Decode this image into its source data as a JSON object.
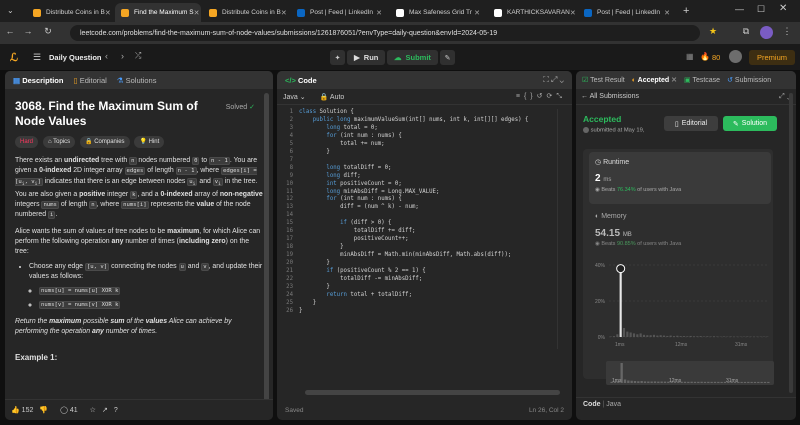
{
  "browser": {
    "tabs": [
      {
        "label": "Distribute Coins in B",
        "color": "#f5a623",
        "active": false
      },
      {
        "label": "Find the Maximum S",
        "color": "#f5a623",
        "active": true
      },
      {
        "label": "Distribute Coins in B",
        "color": "#f5a623",
        "active": false
      },
      {
        "label": "Post | Feed | LinkedIn",
        "color": "#0a66c2",
        "active": false
      },
      {
        "label": "Max Safeness Grid Tr",
        "color": "#ffffff",
        "active": false
      },
      {
        "label": "KARTHICKSAVARAN",
        "color": "#ffffff",
        "active": false
      },
      {
        "label": "Post | Feed | LinkedIn",
        "color": "#0a66c2",
        "active": false
      }
    ],
    "url": "leetcode.com/problems/find-the-maximum-sum-of-node-values/submissions/1261876051/?envType=daily-question&envId=2024-05-19"
  },
  "header": {
    "problem_list": "Daily Question",
    "run": "Run",
    "submit": "Submit",
    "streak": "80",
    "premium": "Premium"
  },
  "left": {
    "tabs": [
      "Description",
      "Editorial",
      "Solutions"
    ],
    "title": "3068. Find the Maximum Sum of Node Values",
    "solved": "Solved",
    "difficulty": "Hard",
    "tags": [
      "Topics",
      "Companies",
      "Hint"
    ],
    "likes": "152",
    "comments": "41",
    "example": "Example 1:"
  },
  "code": {
    "title": "Code",
    "lang": "Java",
    "auto": "Auto",
    "lines": [
      [
        [
          "kw",
          "class "
        ],
        [
          "tx",
          "Solution {"
        ]
      ],
      [
        [
          "tx",
          "    "
        ],
        [
          "kw",
          "public long "
        ],
        [
          "tx",
          "maximumValueSum(int[] nums, int k, int[][] edges) {"
        ]
      ],
      [
        [
          "tx",
          "        "
        ],
        [
          "kw",
          "long "
        ],
        [
          "tx",
          "total = 0;"
        ]
      ],
      [
        [
          "tx",
          "        "
        ],
        [
          "kw",
          "for "
        ],
        [
          "tx",
          "(int num : nums) {"
        ]
      ],
      [
        [
          "tx",
          "            total += num;"
        ]
      ],
      [
        [
          "tx",
          "        }"
        ]
      ],
      [
        [
          "tx",
          ""
        ]
      ],
      [
        [
          "tx",
          "        "
        ],
        [
          "kw",
          "long "
        ],
        [
          "tx",
          "totalDiff = 0;"
        ]
      ],
      [
        [
          "tx",
          "        "
        ],
        [
          "kw",
          "long "
        ],
        [
          "tx",
          "diff;"
        ]
      ],
      [
        [
          "tx",
          "        "
        ],
        [
          "kw",
          "int "
        ],
        [
          "tx",
          "positiveCount = 0;"
        ]
      ],
      [
        [
          "tx",
          "        "
        ],
        [
          "kw",
          "long "
        ],
        [
          "tx",
          "minAbsDiff = Long.MAX_VALUE;"
        ]
      ],
      [
        [
          "tx",
          "        "
        ],
        [
          "kw",
          "for "
        ],
        [
          "tx",
          "(int num : nums) {"
        ]
      ],
      [
        [
          "tx",
          "            diff = (num ^ k) - num;"
        ]
      ],
      [
        [
          "tx",
          ""
        ]
      ],
      [
        [
          "tx",
          "            "
        ],
        [
          "kw",
          "if "
        ],
        [
          "tx",
          "(diff > 0) {"
        ]
      ],
      [
        [
          "tx",
          "                totalDiff += diff;"
        ]
      ],
      [
        [
          "tx",
          "                positiveCount++;"
        ]
      ],
      [
        [
          "tx",
          "            }"
        ]
      ],
      [
        [
          "tx",
          "            minAbsDiff = Math.min(minAbsDiff, Math.abs(diff));"
        ]
      ],
      [
        [
          "tx",
          "        }"
        ]
      ],
      [
        [
          "tx",
          "        "
        ],
        [
          "kw",
          "if "
        ],
        [
          "tx",
          "(positiveCount % 2 == 1) {"
        ]
      ],
      [
        [
          "tx",
          "            totalDiff -= minAbsDiff;"
        ]
      ],
      [
        [
          "tx",
          "        }"
        ]
      ],
      [
        [
          "tx",
          "        "
        ],
        [
          "kw",
          "return "
        ],
        [
          "tx",
          "total + totalDiff;"
        ]
      ],
      [
        [
          "tx",
          "    }"
        ]
      ],
      [
        [
          "tx",
          "}"
        ]
      ]
    ],
    "status": "Saved",
    "cursor": "Ln 26, Col 2"
  },
  "right": {
    "tabs": [
      "Test Result",
      "Accepted",
      "Testcase",
      "Submission"
    ],
    "all": "All Submissions",
    "accepted": "Accepted",
    "submitted": "submitted at May 19,",
    "editorial": "Editorial",
    "solution": "Solution",
    "runtime": {
      "label": "Runtime",
      "value": "2",
      "unit": "ms",
      "beats_label": "Beats",
      "beats_value": "76.34%",
      "beats_suffix": "of users with Java"
    },
    "memory": {
      "label": "Memory",
      "value": "54.15",
      "unit": "MB",
      "beats_label": "Beats",
      "beats_value": "90.85%",
      "beats_suffix": "of users with Java"
    },
    "chart_data": {
      "type": "bar",
      "yticks": [
        "40%",
        "20%",
        "0%"
      ],
      "xticks": [
        "1ms",
        "12ms",
        "31ms"
      ],
      "values": [
        0.3,
        0.5,
        1.5,
        38,
        5,
        3,
        2.5,
        2,
        1.5,
        2,
        1.2,
        1,
        1,
        1.2,
        0.8,
        1,
        0.8,
        0.6,
        0.8,
        0.5,
        0.7,
        0.5,
        0.5,
        0.4,
        0.6,
        0.4,
        0.4,
        0.5,
        0.3,
        0.4,
        0.3,
        0.4,
        0.3,
        0.2,
        0.3,
        0.2,
        0.3,
        0.2,
        0.2,
        0.2,
        0.2,
        0.3,
        0.2,
        0.2,
        0.2,
        0.2,
        0.2,
        0.2
      ],
      "highlight_index": 3,
      "ylim": [
        0,
        40
      ]
    },
    "mini_xticks": [
      "1ms",
      "12ms",
      "31ms"
    ],
    "footer_code": "Code",
    "footer_lang": "Java"
  }
}
